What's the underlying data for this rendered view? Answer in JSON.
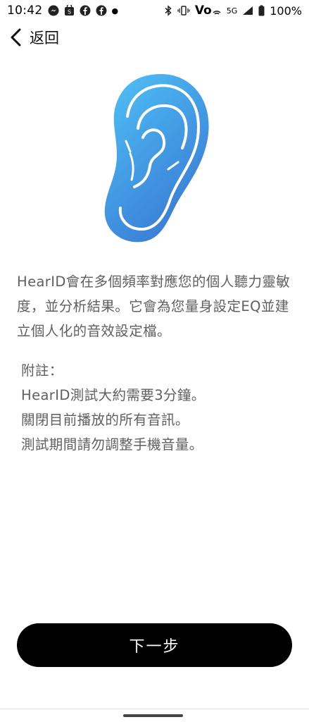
{
  "status_bar": {
    "time": "10:42",
    "left_icons": [
      "messenger-icon",
      "shop-icon",
      "facebook-icon",
      "facebook-icon",
      "dot-icon"
    ],
    "right_icons": [
      "bluetooth-icon",
      "vibrate-icon",
      "volte-icon",
      "network-5g-icon",
      "signal-icon",
      "battery-icon"
    ],
    "network_label": "5G",
    "volte_label": "Vo",
    "battery": "100%"
  },
  "nav": {
    "back_label": "返回"
  },
  "description": "HearID會在多個頻率對應您的個人聽力靈敏度，並分析結果。它會為您量身設定EQ並建立個人化的音效設定檔。",
  "notes": {
    "heading": "附註：",
    "lines": [
      "HearID測試大約需要3分鐘。",
      "關閉目前播放的所有音訊。",
      "測試期間請勿調整手機音量。"
    ]
  },
  "next_button": {
    "label": "下一步"
  },
  "colors": {
    "ear_gradient_top": "#4fc3f7",
    "ear_gradient_bottom": "#3a7bd5",
    "text_gray": "#5f5f5f",
    "button_bg": "#000000",
    "button_text": "#ffffff"
  }
}
